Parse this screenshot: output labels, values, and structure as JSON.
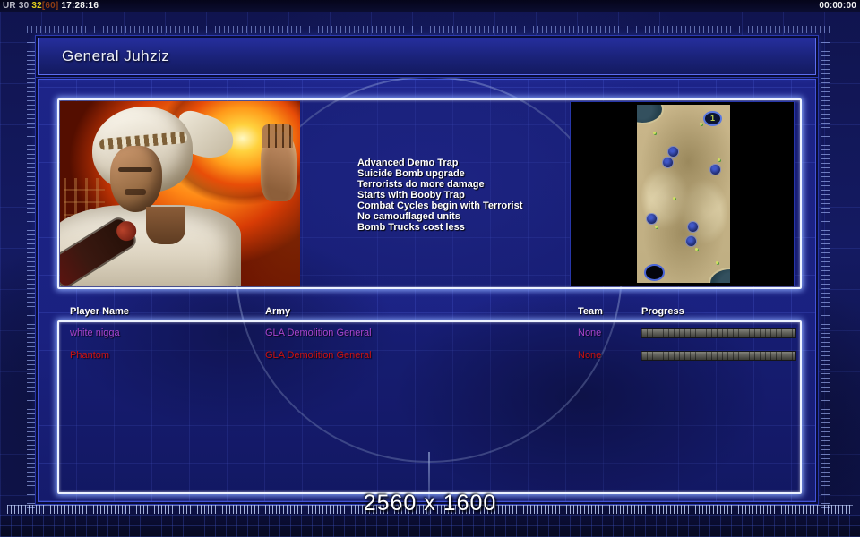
{
  "status_bar": {
    "left": {
      "label": "UR 30",
      "fps": "32",
      "cap": "[60]",
      "clock": "17:28:16"
    },
    "right_timer": "00:00:00"
  },
  "header": {
    "title": "General Juhziz"
  },
  "general": {
    "perks": [
      "Advanced Demo Trap",
      "Suicide Bomb upgrade",
      "Terrorists do more damage",
      "Starts with Booby Trap",
      "Combat Cycles begin with Terrorist",
      "No camouflaged units",
      "Bomb Trucks cost less"
    ]
  },
  "map": {
    "start_label": "1"
  },
  "player_table": {
    "columns": [
      "Player Name",
      "Army",
      "Team",
      "Progress"
    ],
    "rows": [
      {
        "player": "white nigga",
        "army": "GLA Demolition General",
        "team": "None",
        "color": "#a844cc"
      },
      {
        "player": "Phantom",
        "army": "GLA Demolition General",
        "team": "None",
        "color": "#cc1111"
      }
    ]
  },
  "footer": {
    "resolution": "2560 x 1600"
  },
  "colors": {
    "frame_glow": "#ecf2ff",
    "panel_blue": "#1d2488",
    "accent_border": "#4353d8"
  }
}
